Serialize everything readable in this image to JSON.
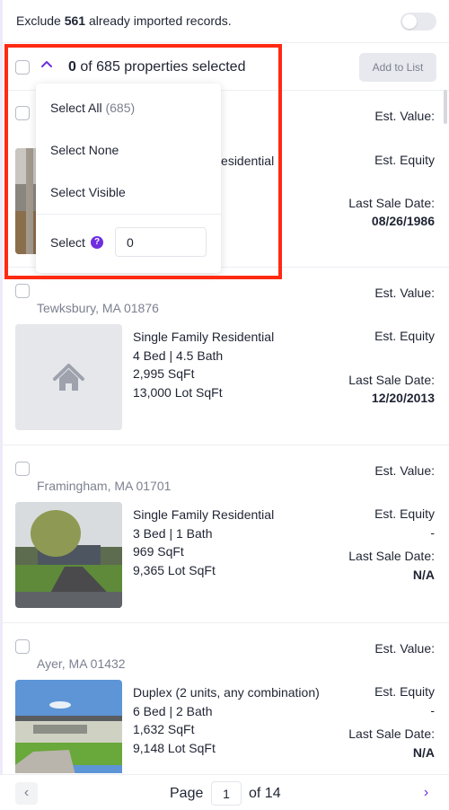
{
  "exclude": {
    "prefix": "Exclude ",
    "count": "561",
    "suffix": " already imported records.",
    "toggle_on": false
  },
  "selection": {
    "selected": "0",
    "summary": " of 685 properties selected",
    "add_button": "Add to List"
  },
  "menu": {
    "select_all": "Select All",
    "select_all_count": "(685)",
    "select_none": "Select None",
    "select_visible": "Select Visible",
    "select_label": "Select",
    "help_glyph": "?",
    "select_value": "0"
  },
  "labels": {
    "est_value": "Est. Value:",
    "est_equity": "Est. Equity",
    "last_sale": "Last Sale Date:"
  },
  "properties": [
    {
      "location": "",
      "type": "Single Family Residential",
      "beds_baths": "",
      "sqft": "",
      "lot": "",
      "equity": "",
      "last_sale": "08/26/1986",
      "image": "photo"
    },
    {
      "location": "Tewksbury, MA 01876",
      "type": "Single Family Residential",
      "beds_baths": "4 Bed | 4.5 Bath",
      "sqft": "2,995 SqFt",
      "lot": "13,000 Lot SqFt",
      "equity": "",
      "last_sale": "12/20/2013",
      "image": "placeholder"
    },
    {
      "location": "Framingham, MA 01701",
      "type": "Single Family Residential",
      "beds_baths": "3 Bed | 1 Bath",
      "sqft": "969 SqFt",
      "lot": "9,365 Lot SqFt",
      "equity": "-",
      "last_sale": "N/A",
      "image": "photo"
    },
    {
      "location": "Ayer, MA 01432",
      "type": "Duplex (2 units, any combination)",
      "beds_baths": "6 Bed | 2 Bath",
      "sqft": "1,632 SqFt",
      "lot": "9,148 Lot SqFt",
      "equity": "-",
      "last_sale": "N/A",
      "image": "photo"
    }
  ],
  "pager": {
    "prev": "‹",
    "label": "Page",
    "current": "1",
    "of": "of 14",
    "next": "›"
  },
  "colors": {
    "accent": "#6f2ee0",
    "highlight": "#ff2a12"
  }
}
